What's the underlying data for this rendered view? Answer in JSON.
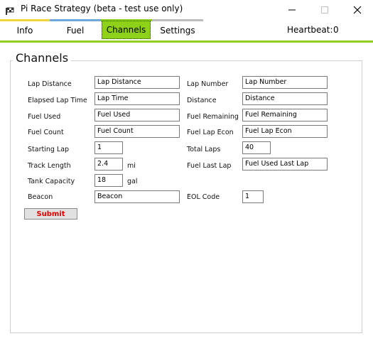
{
  "window": {
    "title": "Pi Race Strategy (beta - test use only)",
    "icon": "app-flag-icon"
  },
  "tabs": [
    {
      "label": "Info",
      "accent": "#f2d43a",
      "selected": false
    },
    {
      "label": "Fuel",
      "accent": "#6fa8dc",
      "selected": false
    },
    {
      "label": "Channels",
      "accent": "#8fd11a",
      "selected": true
    },
    {
      "label": "Settings",
      "accent": "#bdbdbd",
      "selected": false
    }
  ],
  "heartbeat": {
    "label": "Heartbeat:",
    "value": "0"
  },
  "colors": {
    "accent": "#8fd11a",
    "submit_text": "#e00000"
  },
  "channels": {
    "title": "Channels",
    "fields": {
      "lap_distance": {
        "label": "Lap Distance",
        "value": "Lap Distance"
      },
      "lap_number": {
        "label": "Lap Number",
        "value": "Lap Number"
      },
      "elapsed_lap_time": {
        "label": "Elapsed Lap Time",
        "value": "Lap Time"
      },
      "distance": {
        "label": "Distance",
        "value": "Distance"
      },
      "fuel_used": {
        "label": "Fuel Used",
        "value": "Fuel Used"
      },
      "fuel_remaining": {
        "label": "Fuel Remaining",
        "value": "Fuel Remaining"
      },
      "fuel_count": {
        "label": "Fuel Count",
        "value": "Fuel Count"
      },
      "fuel_lap_econ": {
        "label": "Fuel Lap Econ",
        "value": "Fuel Lap Econ"
      },
      "starting_lap": {
        "label": "Starting Lap",
        "value": "1"
      },
      "total_laps": {
        "label": "Total Laps",
        "value": "40"
      },
      "track_length": {
        "label": "Track Length",
        "value": "2.4",
        "unit": "mi"
      },
      "fuel_last_lap": {
        "label": "Fuel Last Lap",
        "value": "Fuel Used Last Lap"
      },
      "tank_capacity": {
        "label": "Tank Capacity",
        "value": "18",
        "unit": "gal"
      },
      "beacon": {
        "label": "Beacon",
        "value": "Beacon"
      },
      "eol_code": {
        "label": "EOL Code",
        "value": "1"
      }
    },
    "submit_label": "Submit"
  }
}
